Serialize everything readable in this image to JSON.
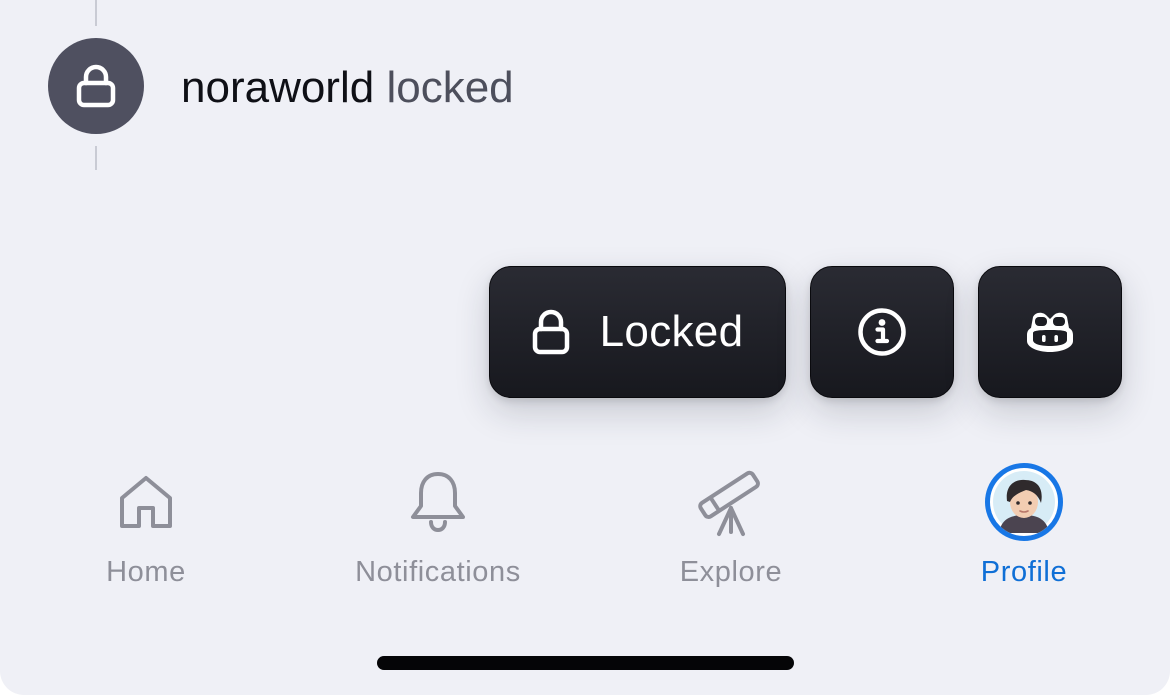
{
  "event": {
    "username": "noraworld",
    "action": "locked",
    "icon": "lock-icon",
    "badge_color": "#4f5060"
  },
  "actions": {
    "locked_label": "Locked",
    "locked_icon": "lock-icon",
    "info_icon": "info-circle-icon",
    "copilot_icon": "copilot-icon",
    "background": "#1c1d23"
  },
  "tabbar": {
    "items": [
      {
        "label": "Home",
        "icon": "home-icon",
        "active": false
      },
      {
        "label": "Notifications",
        "icon": "bell-icon",
        "active": false
      },
      {
        "label": "Explore",
        "icon": "telescope-icon",
        "active": false
      },
      {
        "label": "Profile",
        "icon": "avatar",
        "active": true
      }
    ],
    "inactive_color": "#8e8f99",
    "active_color": "#0f6fd6"
  }
}
